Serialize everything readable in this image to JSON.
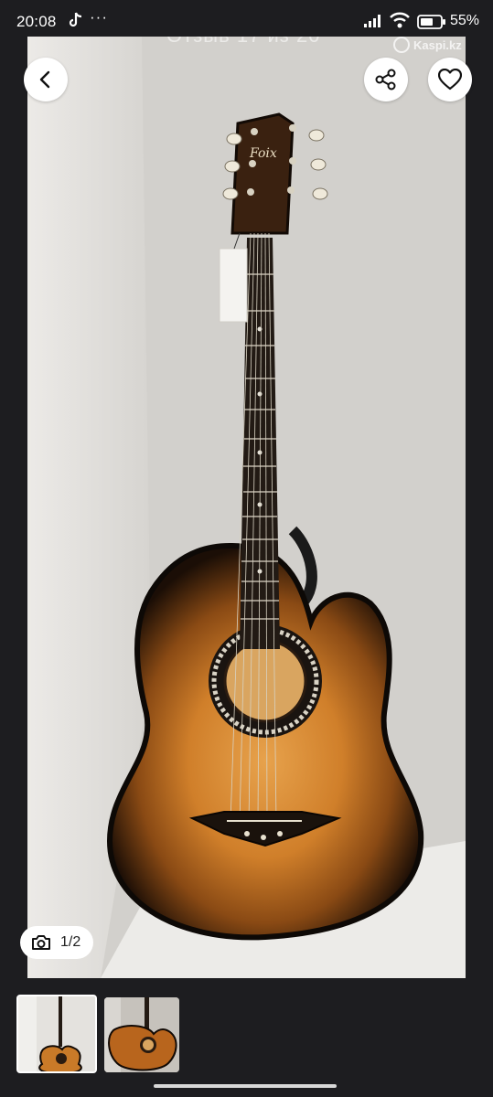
{
  "status_bar": {
    "time": "20:08",
    "more_indicator": "···",
    "battery_percent": "55%",
    "icons": [
      "tiktok-icon",
      "signal-icon",
      "wifi-icon",
      "battery-icon"
    ]
  },
  "gallery": {
    "watermark": "Kaspi.kz",
    "blurred_caption": "Отзыв 17 из 20",
    "guitar_headstock_brand": "Foix",
    "counter": "1/2",
    "buttons": {
      "back": "back-arrow-icon",
      "share": "share-icon",
      "favorite": "heart-icon"
    },
    "thumbnails": [
      {
        "selected": true
      },
      {
        "selected": false
      }
    ]
  },
  "colors": {
    "background": "#1d1d20",
    "button_bg": "#ffffff",
    "thumb_selected_border": "#ffffff"
  }
}
